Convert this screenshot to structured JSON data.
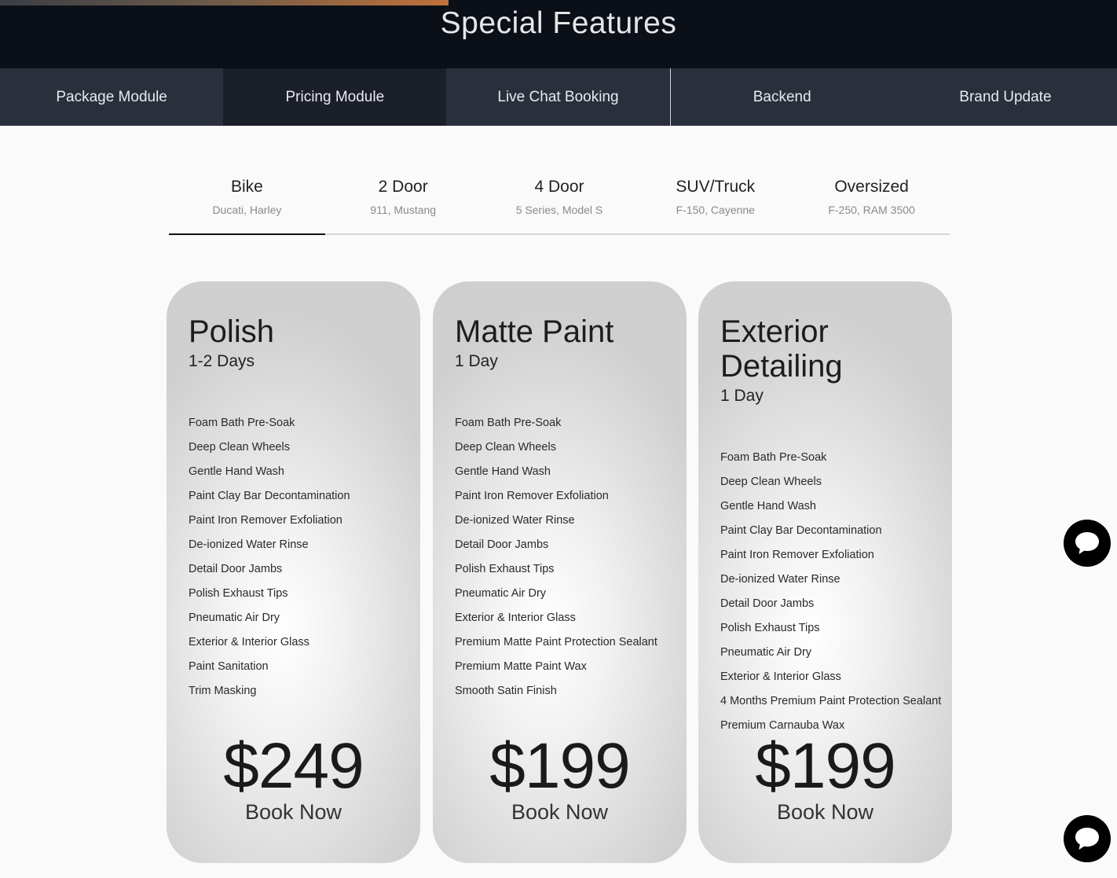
{
  "header": {
    "title": "Special Features"
  },
  "module_tabs": [
    {
      "label": "Package Module"
    },
    {
      "label": "Pricing Module"
    },
    {
      "label": "Live Chat Booking"
    },
    {
      "label": "Backend"
    },
    {
      "label": "Brand Update"
    }
  ],
  "vehicle_tabs": [
    {
      "name": "Bike",
      "examples": "Ducati, Harley",
      "active": true
    },
    {
      "name": "2 Door",
      "examples": "911, Mustang",
      "active": false
    },
    {
      "name": "4 Door",
      "examples": "5 Series, Model S",
      "active": false
    },
    {
      "name": "SUV/Truck",
      "examples": "F-150, Cayenne",
      "active": false
    },
    {
      "name": "Oversized",
      "examples": "F-250, RAM 3500",
      "active": false
    }
  ],
  "packages": [
    {
      "title": "Polish",
      "duration": "1-2 Days",
      "features": [
        "Foam Bath Pre-Soak",
        "Deep Clean Wheels",
        "Gentle Hand Wash",
        "Paint Clay Bar Decontamination",
        "Paint Iron Remover Exfoliation",
        "De-ionized Water Rinse",
        "Detail Door Jambs",
        "Polish Exhaust Tips",
        "Pneumatic Air Dry",
        "Exterior & Interior Glass",
        "Paint Sanitation",
        "Trim Masking"
      ],
      "price": "$249",
      "cta": "Book Now"
    },
    {
      "title": "Matte Paint",
      "duration": "1 Day",
      "features": [
        "Foam Bath Pre-Soak",
        "Deep Clean Wheels",
        "Gentle Hand Wash",
        "Paint Iron Remover Exfoliation",
        "De-ionized Water Rinse",
        "Detail Door Jambs",
        "Polish Exhaust Tips",
        "Pneumatic Air Dry",
        "Exterior & Interior Glass",
        "Premium Matte Paint Protection Sealant",
        "Premium Matte Paint Wax",
        "Smooth Satin Finish"
      ],
      "price": "$199",
      "cta": "Book Now"
    },
    {
      "title": "Exterior Detailing",
      "duration": "1 Day",
      "features": [
        "Foam Bath Pre-Soak",
        "Deep Clean Wheels",
        "Gentle Hand Wash",
        "Paint Clay Bar Decontamination",
        "Paint Iron Remover Exfoliation",
        "De-ionized Water Rinse",
        "Detail Door Jambs",
        "Polish Exhaust Tips",
        "Pneumatic Air Dry",
        "Exterior & Interior Glass",
        "4 Months Premium Paint Protection Sealant",
        "Premium Carnauba Wax"
      ],
      "price": "$199",
      "cta": "Book Now"
    }
  ],
  "chat_widgets": [
    {
      "icon": "chat-bubble-icon"
    },
    {
      "icon": "chat-bubble-icon"
    }
  ],
  "colors": {
    "header_bg": "#0b0f18",
    "nav_bg": "#2a2f3c",
    "nav_bg_dark": "#1b1f29",
    "accent": "#c0713a"
  }
}
